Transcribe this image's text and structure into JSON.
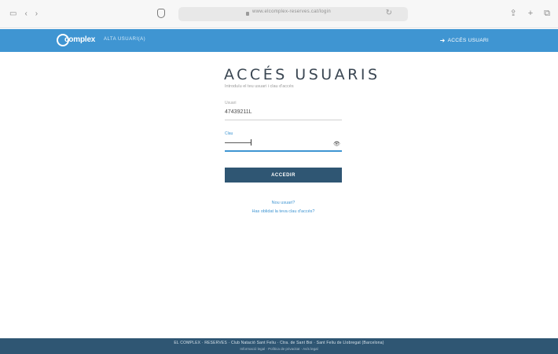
{
  "browser": {
    "url": "www.elcomplex-reserves.cat/login",
    "toolbar_left_icons": [
      "sidebar-icon",
      "back-icon",
      "forward-icon"
    ],
    "toolbar_right_icons": [
      "share-icon",
      "new-tab-icon",
      "tabs-icon"
    ]
  },
  "header": {
    "brand": "complex",
    "brand_sub": "ALTA USUARI(A)",
    "access_label": "ACCÉS USUARI"
  },
  "login": {
    "title": "ACCÉS USUARIS",
    "subtitle": "Introduïu el teu usuari i clau d'accés",
    "user_label": "Usuari",
    "user_value": "47439211L",
    "password_label": "Clau",
    "submit_label": "ACCEDIR",
    "link_forgot_user": "Nou usuari?",
    "link_forgot_password": "Has oblidat la teva clau d'accés?"
  },
  "footer": {
    "line1": "EL COMPLEX · RESERVES · Club Natació Sant Feliu · Ctra. de Sant Boi · Sant Feliu de Llobregat (Barcelona)",
    "line2": "Informació legal · Política de privacitat · Avís legal"
  },
  "colors": {
    "header_blue": "#3f95d2",
    "button_navy": "#2f5673",
    "footer_navy": "#2f5673"
  }
}
